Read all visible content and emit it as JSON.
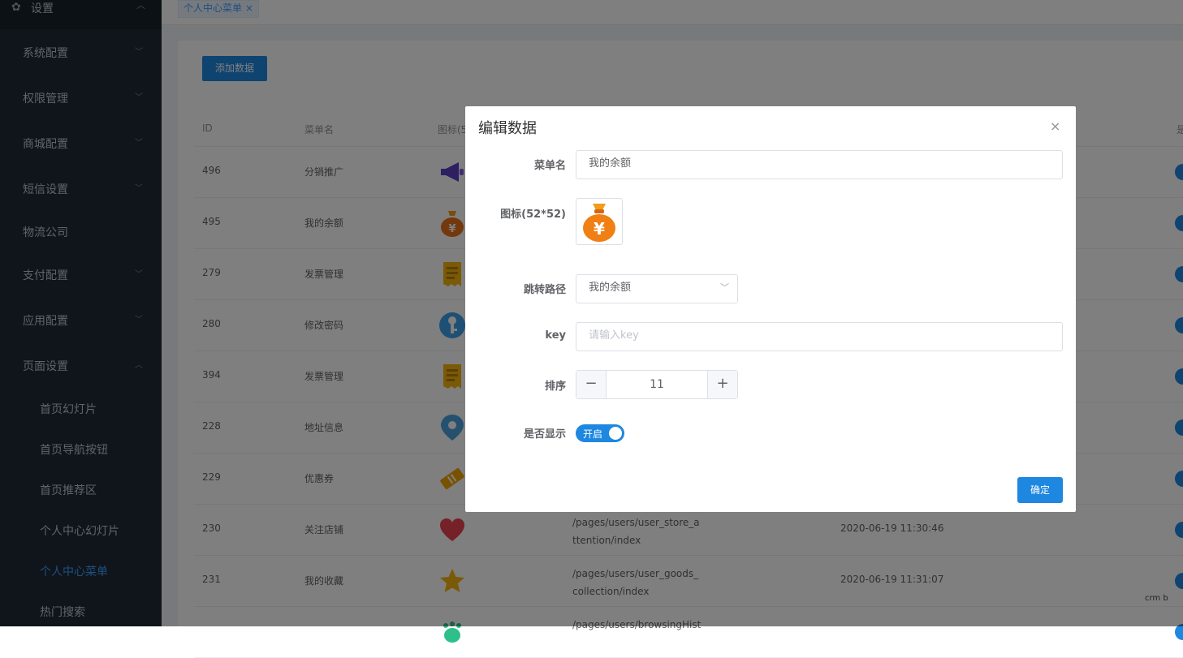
{
  "sidebar": {
    "top": {
      "label": "设置"
    },
    "items": [
      {
        "label": "系统配置"
      },
      {
        "label": "权限管理"
      },
      {
        "label": "商城配置"
      },
      {
        "label": "短信设置"
      },
      {
        "label": "物流公司"
      },
      {
        "label": "支付配置"
      },
      {
        "label": "应用配置"
      },
      {
        "label": "页面设置"
      }
    ],
    "sub_items": [
      {
        "label": "首页幻灯片"
      },
      {
        "label": "首页导航按钮"
      },
      {
        "label": "首页推荐区"
      },
      {
        "label": "个人中心幻灯片"
      },
      {
        "label": "个人中心菜单"
      },
      {
        "label": "热门搜索"
      }
    ]
  },
  "tabs": [
    {
      "label": "个人中心菜单",
      "close": "×"
    }
  ],
  "toolbar": {
    "add_label": "添加数据"
  },
  "table": {
    "headers": {
      "id": "ID",
      "name": "菜单名",
      "icon": "图标(5",
      "show": "是"
    },
    "rows": [
      {
        "id": "496",
        "name": "分销推广",
        "icon": "megaphone-icon",
        "path1": "",
        "path2": "",
        "time": ""
      },
      {
        "id": "495",
        "name": "我的余额",
        "icon": "money-bag-icon",
        "path1": "",
        "path2": "",
        "time": ""
      },
      {
        "id": "279",
        "name": "发票管理",
        "icon": "invoice-icon",
        "path1": "",
        "path2": "",
        "time": ""
      },
      {
        "id": "280",
        "name": "修改密码",
        "icon": "key-icon",
        "path1": "",
        "path2": "",
        "time": ""
      },
      {
        "id": "394",
        "name": "发票管理",
        "icon": "invoice-icon",
        "path1": "",
        "path2": "",
        "time": ""
      },
      {
        "id": "228",
        "name": "地址信息",
        "icon": "location-pin-icon",
        "path1": "",
        "path2": "",
        "time": ""
      },
      {
        "id": "229",
        "name": "优惠券",
        "icon": "coupon-icon",
        "path1": "",
        "path2": "",
        "time": ""
      },
      {
        "id": "230",
        "name": "关注店铺",
        "icon": "heart-icon",
        "path1": "/pages/users/user_store_a",
        "path2": "ttention/index",
        "time": "2020-06-19 11:30:46"
      },
      {
        "id": "231",
        "name": "我的收藏",
        "icon": "star-icon",
        "path1": "/pages/users/user_goods_",
        "path2": "collection/index",
        "time": "2020-06-19 11:31:07"
      },
      {
        "id": "",
        "name": "",
        "icon": "footprint-icon",
        "path1": "/pages/users/browsingHist",
        "path2": "",
        "time": ""
      }
    ]
  },
  "dialog": {
    "title": "编辑数据",
    "close": "×",
    "menu_name_label": "菜单名",
    "menu_name_value": "我的余额",
    "icon_label": "图标(52*52)",
    "icon_name": "money-bag-icon",
    "path_label": "跳转路径",
    "path_value": "我的余额",
    "key_label": "key",
    "key_placeholder": "请输入key",
    "sort_label": "排序",
    "sort_value": "11",
    "sort_dec": "−",
    "sort_inc": "+",
    "show_label": "是否显示",
    "show_switch_text": "开启",
    "confirm_label": "确定"
  },
  "colors": {
    "accent": "#1e87e0",
    "sidebar_bg": "#1e2a36",
    "active_text": "#409eff"
  },
  "watermark": "crm b"
}
